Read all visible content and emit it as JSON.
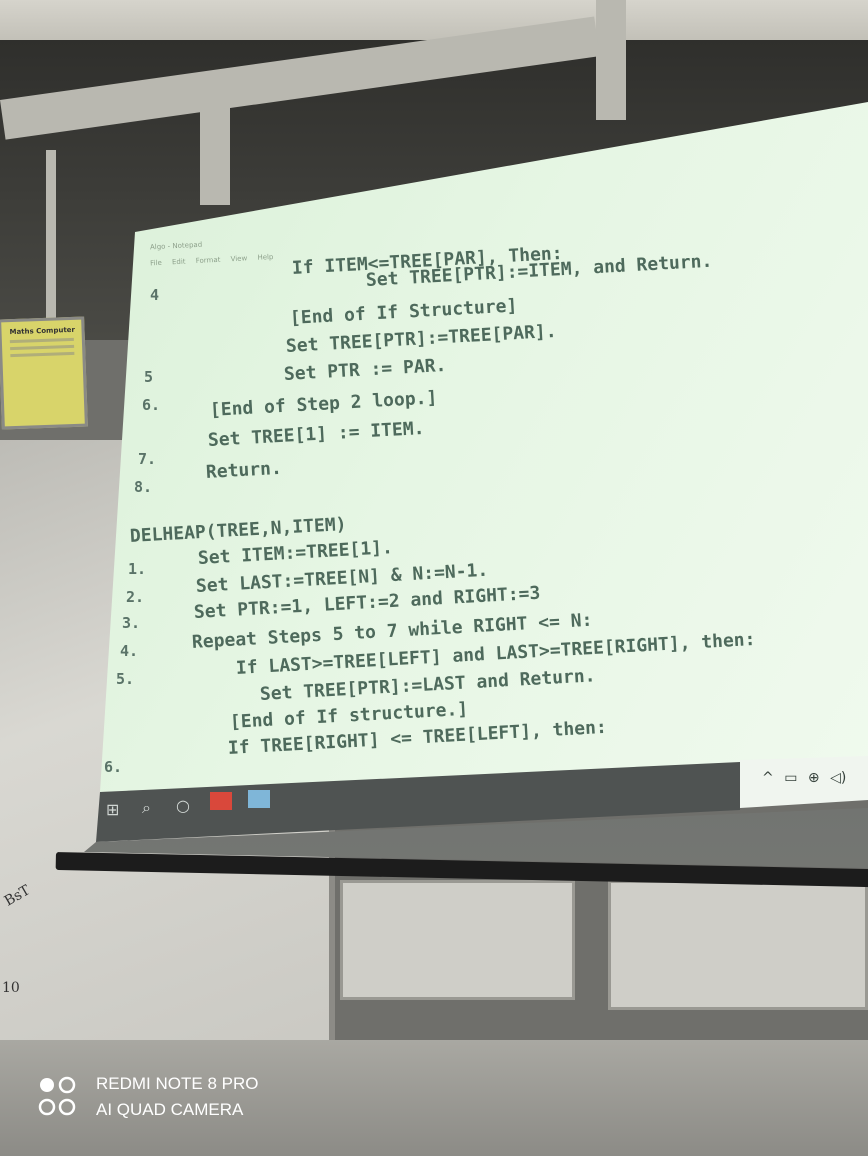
{
  "notepad": {
    "title": "Algo - Notepad",
    "menu": [
      "File",
      "Edit",
      "Format",
      "View",
      "Help"
    ]
  },
  "code": {
    "block1": [
      {
        "num": "",
        "text": "If ITEM<=TREE[PAR], Then:"
      },
      {
        "num": "",
        "text": "Set TREE[PTR]:=ITEM, and Return."
      },
      {
        "num": "4",
        "text": ""
      },
      {
        "num": "",
        "text": "[End of If Structure]"
      },
      {
        "num": "",
        "text": "Set TREE[PTR]:=TREE[PAR]."
      },
      {
        "num": "5",
        "text": "Set PTR := PAR."
      },
      {
        "num": "6.",
        "text": "[End of Step 2 loop.]"
      },
      {
        "num": "",
        "text": "Set TREE[1] := ITEM."
      },
      {
        "num": "7.",
        "text": ""
      },
      {
        "num": "8.",
        "text": "Return."
      }
    ],
    "block2_header": "DELHEAP(TREE,N,ITEM)",
    "block2": [
      {
        "num": "1.",
        "text": "Set ITEM:=TREE[1]."
      },
      {
        "num": "2.",
        "text": "Set LAST:=TREE[N] & N:=N-1."
      },
      {
        "num": "3.",
        "text": "Set PTR:=1, LEFT:=2 and RIGHT:=3"
      },
      {
        "num": "4.",
        "text": "Repeat Steps 5 to 7 while RIGHT <= N:"
      },
      {
        "num": "5.",
        "text": "If LAST>=TREE[LEFT] and LAST>=TREE[RIGHT], then:"
      },
      {
        "num": "",
        "text": "Set TREE[PTR]:=LAST and Return."
      },
      {
        "num": "",
        "text": "[End of If structure.]"
      },
      {
        "num": "",
        "text": "If TREE[RIGHT] <= TREE[LEFT], then:"
      },
      {
        "num": "6.",
        "text": ""
      }
    ]
  },
  "taskbar": {
    "icons": [
      "windows-start-icon",
      "search-icon",
      "task-view-icon",
      "presentation-app-icon",
      "notepad-app-icon"
    ],
    "tray_icons": [
      "chevron-up-icon",
      "battery-icon",
      "globe-icon",
      "speaker-icon"
    ]
  },
  "notice_board": {
    "title": "Maths Computer"
  },
  "whiteboard": {
    "scribbles": [
      "BsT",
      "10"
    ]
  },
  "watermark": {
    "line1": "REDMI NOTE 8 PRO",
    "line2": "AI QUAD CAMERA"
  }
}
